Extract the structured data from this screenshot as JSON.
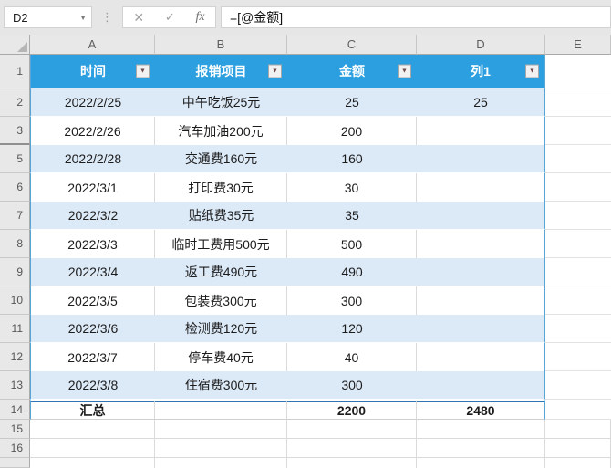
{
  "formula_bar": {
    "name_box_value": "D2",
    "formula_value": "=[@金额]",
    "fx_label": "fx"
  },
  "icons": {
    "name_box_dropdown": "▼",
    "separator_dots": "⋮",
    "cancel": "✕",
    "enter": "✓",
    "filter_arrow": "▼"
  },
  "colors": {
    "header_fill": "#2B9FE0",
    "band_fill": "#DCE9F7",
    "table_border": "#58A6D8",
    "total_border": "#2F74B5"
  },
  "sheet": {
    "column_letters": [
      "A",
      "B",
      "C",
      "D",
      "E"
    ],
    "table": {
      "header_row": {
        "row": 1,
        "labels": [
          "时间",
          "报销项目",
          "金额",
          "列1"
        ]
      },
      "data_rows": [
        {
          "row": 2,
          "date": "2022/2/25",
          "item": "中午吃饭25元",
          "amount": "25",
          "col1": "25"
        },
        {
          "row": 3,
          "date": "2022/2/26",
          "item": "汽车加油200元",
          "amount": "200",
          "col1": ""
        },
        {
          "row": 5,
          "date": "2022/2/28",
          "item": "交通费160元",
          "amount": "160",
          "col1": ""
        },
        {
          "row": 6,
          "date": "2022/3/1",
          "item": "打印费30元",
          "amount": "30",
          "col1": ""
        },
        {
          "row": 7,
          "date": "2022/3/2",
          "item": "贴纸费35元",
          "amount": "35",
          "col1": ""
        },
        {
          "row": 8,
          "date": "2022/3/3",
          "item": "临时工费用500元",
          "amount": "500",
          "col1": ""
        },
        {
          "row": 9,
          "date": "2022/3/4",
          "item": "返工费490元",
          "amount": "490",
          "col1": ""
        },
        {
          "row": 10,
          "date": "2022/3/5",
          "item": "包装费300元",
          "amount": "300",
          "col1": ""
        },
        {
          "row": 11,
          "date": "2022/3/6",
          "item": "检测费120元",
          "amount": "120",
          "col1": ""
        },
        {
          "row": 12,
          "date": "2022/3/7",
          "item": "停车费40元",
          "amount": "40",
          "col1": ""
        },
        {
          "row": 13,
          "date": "2022/3/8",
          "item": "住宿费300元",
          "amount": "300",
          "col1": ""
        }
      ],
      "total_row": {
        "row": 14,
        "label": "汇总",
        "item": "",
        "amount": "2200",
        "col1": "2480"
      },
      "empty_row_numbers": [
        15,
        16
      ],
      "hidden_row_number": 4
    }
  }
}
